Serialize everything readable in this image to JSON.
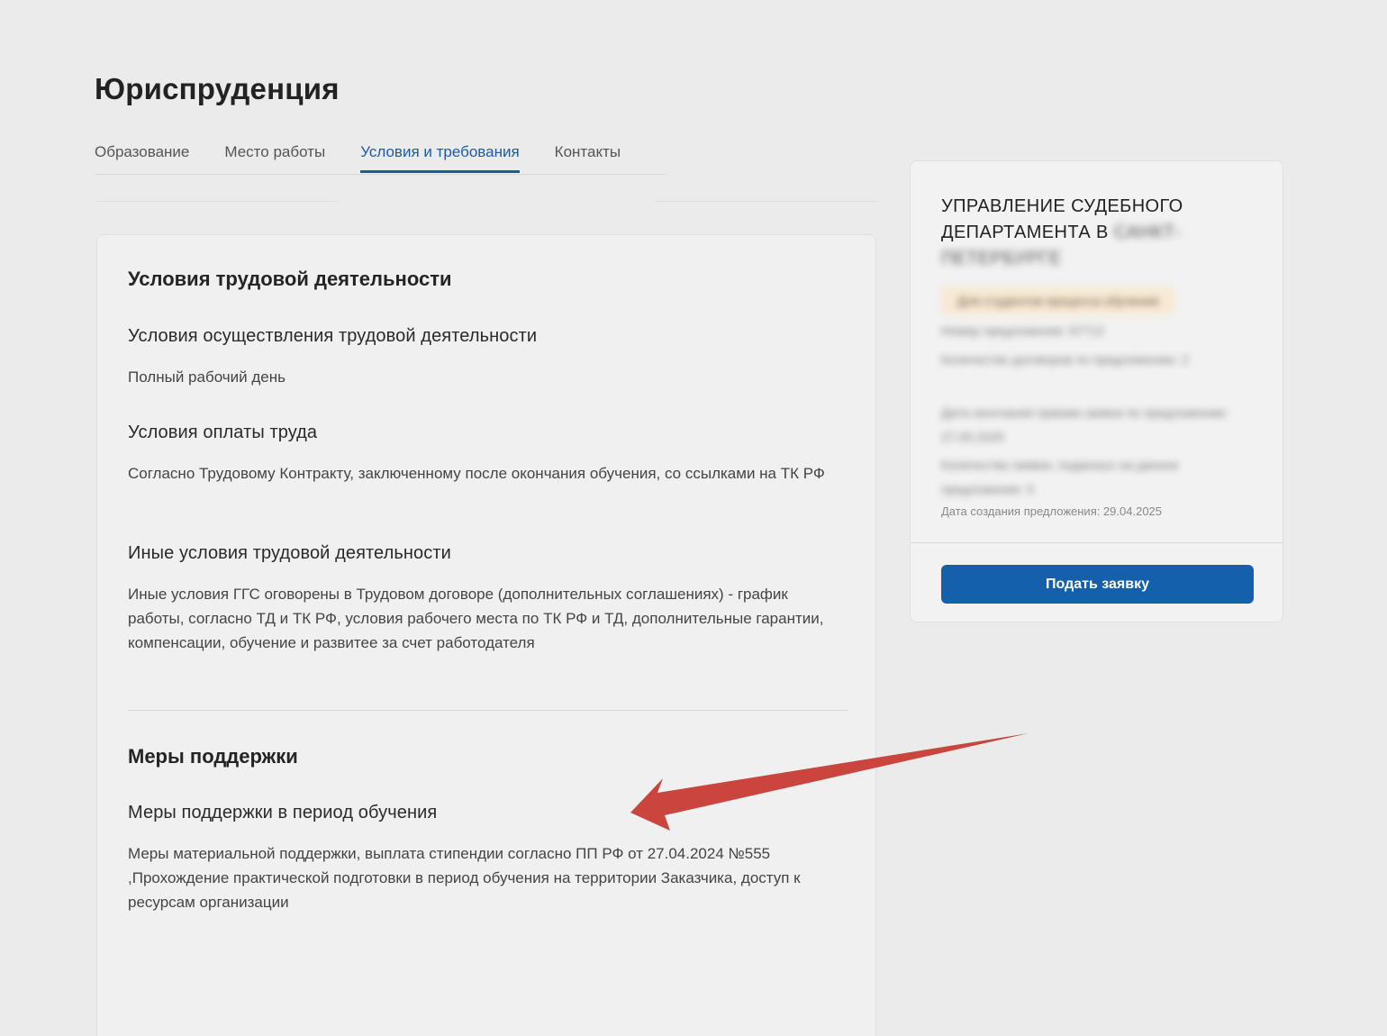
{
  "page": {
    "title": "Юриспруденция"
  },
  "tabs": [
    {
      "label": "Образование"
    },
    {
      "label": "Место работы"
    },
    {
      "label": "Условия и требования"
    },
    {
      "label": "Контакты"
    }
  ],
  "conditions": {
    "title": "Условия трудовой деятельности",
    "items": [
      {
        "title": "Условия осуществления трудовой деятельности",
        "text": "Полный рабочий день"
      },
      {
        "title": "Условия оплаты труда",
        "text": "Согласно Трудовому Контракту, заключенному после окончания обучения, со ссылками на ТК РФ"
      },
      {
        "title": "Иные условия трудовой деятельности",
        "text": "Иные условия ГГС оговорены в Трудовом договоре (дополнительных соглашениях) - график работы, согласно ТД и ТК РФ, условия рабочего места по ТК РФ и ТД, дополнительные гарантии, компенсации, обучение и развитее за счет работодателя"
      }
    ]
  },
  "support": {
    "title": "Меры поддержки",
    "items": [
      {
        "title": "Меры поддержки в период обучения",
        "text": "Меры материальной поддержки, выплата стипендии согласно ПП РФ от 27.04.2024 №555 ,Прохождение практической подготовки в период обучения на территории Заказчика, доступ к ресурсам организации"
      }
    ]
  },
  "sidebar": {
    "org_name": "УПРАВЛЕНИЕ СУДЕБНОГО ДЕПАРТАМЕНТА В",
    "org_name_blurred": "САНКТ-ПЕТЕРБУРГЕ",
    "badge": "Для студентов процесса обучения",
    "lines": [
      "Номер предложения: 97712",
      "Количество договоров по предложению: 2",
      "Дата окончания приема заявок по предложению: 27.05.2025",
      "Количество заявок, поданных на данное предложение: 5"
    ],
    "created": "Дата создания предложения: 29.04.2025",
    "apply_label": "Подать заявку"
  },
  "colors": {
    "accent": "#1d5aa6",
    "button": "#1560ad",
    "arrow": "#c9453e"
  }
}
